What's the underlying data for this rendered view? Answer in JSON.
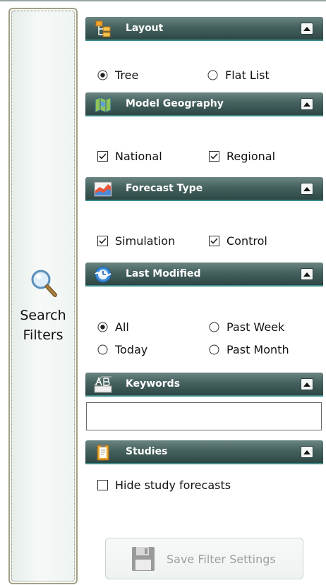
{
  "side_tab": {
    "label_line1": "Search",
    "label_line2": "Filters"
  },
  "sections": {
    "layout": {
      "title": "Layout",
      "options": [
        {
          "label": "Tree",
          "type": "radio",
          "checked": true
        },
        {
          "label": "Flat List",
          "type": "radio",
          "checked": false
        }
      ]
    },
    "geography": {
      "title": "Model Geography",
      "options": [
        {
          "label": "National",
          "type": "checkbox",
          "checked": true
        },
        {
          "label": "Regional",
          "type": "checkbox",
          "checked": true
        }
      ]
    },
    "forecast_type": {
      "title": "Forecast Type",
      "options": [
        {
          "label": "Simulation",
          "type": "checkbox",
          "checked": true
        },
        {
          "label": "Control",
          "type": "checkbox",
          "checked": true
        }
      ]
    },
    "last_modified": {
      "title": "Last Modified",
      "options": [
        {
          "label": "All",
          "type": "radio",
          "checked": true
        },
        {
          "label": "Past Week",
          "type": "radio",
          "checked": false
        },
        {
          "label": "Today",
          "type": "radio",
          "checked": false
        },
        {
          "label": "Past Month",
          "type": "radio",
          "checked": false
        }
      ]
    },
    "keywords": {
      "title": "Keywords",
      "value": ""
    },
    "studies": {
      "title": "Studies",
      "options": [
        {
          "label": "Hide study forecasts",
          "type": "checkbox",
          "checked": false
        }
      ]
    }
  },
  "save_button": {
    "label": "Save Filter Settings",
    "enabled": false
  },
  "colors": {
    "header_top": "#6a8582",
    "header_bottom": "#2d4745",
    "header_accent": "#3e8a89",
    "disabled_text": "#9aa0a0"
  }
}
